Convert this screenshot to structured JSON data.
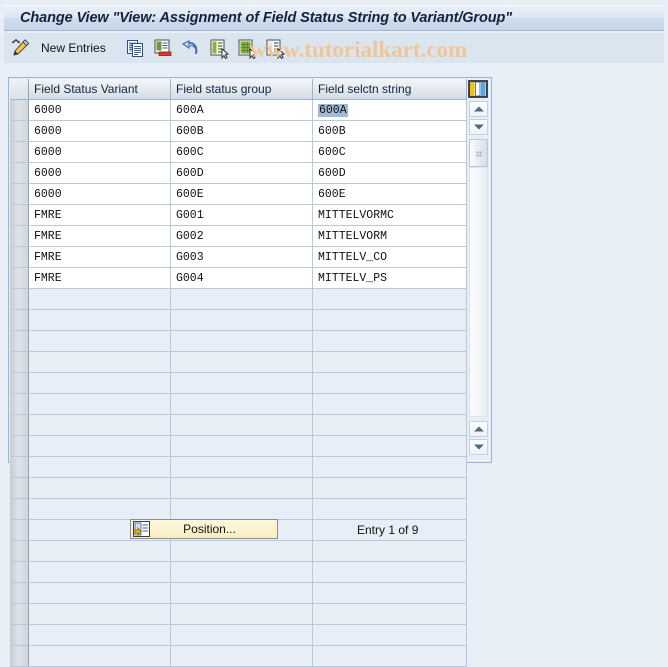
{
  "window": {
    "title": "Change View \"View: Assignment of Field Status String to Variant/Group\""
  },
  "toolbar": {
    "pencil_icon": "pencil-display-change-icon",
    "new_entries_label": "New Entries",
    "buttons": [
      {
        "icon": "copy-icon",
        "name": "copy-as"
      },
      {
        "icon": "delete-icon",
        "name": "delete"
      },
      {
        "icon": "undo-icon",
        "name": "undo"
      },
      {
        "icon": "select-all-icon",
        "name": "select-all"
      },
      {
        "icon": "select-block-icon",
        "name": "select-block"
      },
      {
        "icon": "deselect-all-icon",
        "name": "deselect-all"
      }
    ],
    "watermark": "www.tutorialkart.com",
    "watermark_color": "#f2c596"
  },
  "table": {
    "columns": [
      "Field Status Variant",
      "Field status group",
      "Field selctn string"
    ],
    "selected_cell": {
      "row": 0,
      "col": 2,
      "value": "600A",
      "highlight_color": "#a3bad6"
    },
    "rows": [
      {
        "variant": "6000",
        "group": "600A",
        "string": "600A"
      },
      {
        "variant": "6000",
        "group": "600B",
        "string": "600B"
      },
      {
        "variant": "6000",
        "group": "600C",
        "string": "600C"
      },
      {
        "variant": "6000",
        "group": "600D",
        "string": "600D"
      },
      {
        "variant": "6000",
        "group": "600E",
        "string": "600E"
      },
      {
        "variant": "FMRE",
        "group": "G001",
        "string": "MITTELVORMC"
      },
      {
        "variant": "FMRE",
        "group": "G002",
        "string": "MITTELVORM"
      },
      {
        "variant": "FMRE",
        "group": "G003",
        "string": "MITTELV_CO"
      },
      {
        "variant": "FMRE",
        "group": "G004",
        "string": "MITTELV_PS"
      },
      {
        "variant": "",
        "group": "",
        "string": ""
      },
      {
        "variant": "",
        "group": "",
        "string": ""
      },
      {
        "variant": "",
        "group": "",
        "string": ""
      },
      {
        "variant": "",
        "group": "",
        "string": ""
      },
      {
        "variant": "",
        "group": "",
        "string": ""
      },
      {
        "variant": "",
        "group": "",
        "string": ""
      },
      {
        "variant": "",
        "group": "",
        "string": ""
      },
      {
        "variant": "",
        "group": "",
        "string": ""
      },
      {
        "variant": "",
        "group": "",
        "string": ""
      },
      {
        "variant": "",
        "group": "",
        "string": ""
      },
      {
        "variant": "",
        "group": "",
        "string": ""
      },
      {
        "variant": "",
        "group": "",
        "string": ""
      },
      {
        "variant": "",
        "group": "",
        "string": ""
      },
      {
        "variant": "",
        "group": "",
        "string": ""
      },
      {
        "variant": "",
        "group": "",
        "string": ""
      },
      {
        "variant": "",
        "group": "",
        "string": ""
      },
      {
        "variant": "",
        "group": "",
        "string": ""
      },
      {
        "variant": "",
        "group": "",
        "string": ""
      }
    ],
    "config_icon": "table-settings-icon",
    "scrollbar": {
      "scroll_up_icon": "triangle-up-icon",
      "scroll_down_icon": "triangle-down-icon",
      "thumb_icon": "scroll-thumb-grip-icon",
      "page_up_icon": "triangle-up-icon",
      "page_down_icon": "triangle-down-icon"
    }
  },
  "footer": {
    "position_button_label": "Position...",
    "position_button_icon": "position-jump-icon",
    "entry_status": "Entry 1 of 9"
  }
}
